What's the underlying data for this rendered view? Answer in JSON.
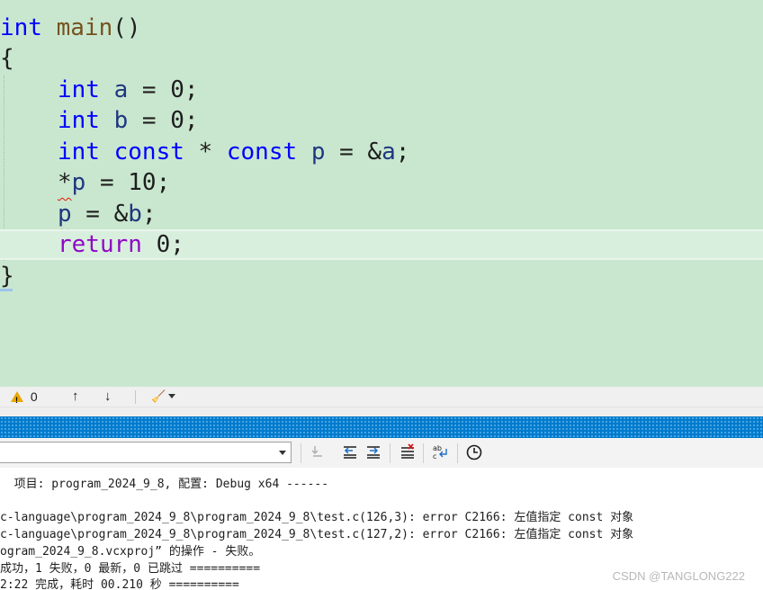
{
  "editor": {
    "lines": [
      {
        "t1": "int",
        "t2": " ",
        "t3": "main",
        "t4": "()"
      },
      {
        "text": "{"
      },
      {
        "t1": "int",
        "t2": " ",
        "t3": "a",
        "t4": " = 0;"
      },
      {
        "t1": "int",
        "t2": " ",
        "t3": "b",
        "t4": " = 0;"
      },
      {
        "t1": "int",
        "t2": " ",
        "t3": "const",
        "t4": " * ",
        "t5": "const",
        "t6": " ",
        "t7": "p",
        "t8": " = &",
        "t9": "a",
        "t10": ";"
      },
      {
        "t1": "*",
        "t2": "p",
        "t3": " = 10;"
      },
      {
        "t1": "p",
        "t2": " = &",
        "t3": "b",
        "t4": ";"
      },
      {
        "t1": "return",
        "t2": " 0;"
      },
      {
        "text": "}"
      }
    ]
  },
  "editor_status": {
    "warning_count": "0",
    "up_arrow": "↑",
    "down_arrow": "↓",
    "brush_glyph": "🧹"
  },
  "output": {
    "lines": [
      "  项目: program_2024_9_8, 配置: Debug x64 ------",
      "",
      "c-language\\program_2024_9_8\\program_2024_9_8\\test.c(126,3): error C2166: 左值指定 const 对象",
      "c-language\\program_2024_9_8\\program_2024_9_8\\test.c(127,2): error C2166: 左值指定 const 对象",
      "ogram_2024_9_8.vcxproj” 的操作 - 失败。",
      "成功，1 失败，0 最新，0 已跳过 ==========",
      "2:22 完成，耗时 00.210 秒 =========="
    ]
  },
  "watermark": "CSDN @TANGLONG222",
  "colors": {
    "editor_bg": "#c9e7cf",
    "keyword": "#0000ff",
    "control_keyword": "#8f08c4",
    "accent_bar": "#007acc"
  }
}
